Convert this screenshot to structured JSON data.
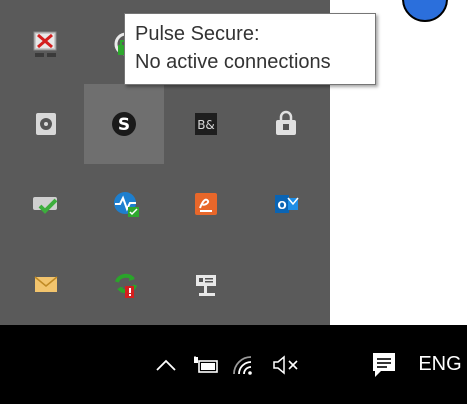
{
  "tooltip": {
    "line1": "Pulse Secure:",
    "line2": "No active connections"
  },
  "tray_overflow": {
    "icons": [
      {
        "name": "network-error-icon"
      },
      {
        "name": "pulse-secure-lock-icon"
      },
      {
        "name": "hard-drive-icon"
      },
      {
        "name": "pulse-secure-icon",
        "hovered": true
      },
      {
        "name": "beats-audio-icon"
      },
      {
        "name": "lock-icon"
      },
      {
        "name": "sync-check-icon"
      },
      {
        "name": "network-monitor-icon"
      },
      {
        "name": "signature-app-icon"
      },
      {
        "name": "outlook-icon"
      },
      {
        "name": "mail-icon"
      },
      {
        "name": "sync-error-icon"
      },
      {
        "name": "projector-icon"
      }
    ]
  },
  "taskbar": {
    "icons": [
      "chevron-up-icon",
      "battery-icon",
      "wifi-icon",
      "volume-muted-icon",
      "action-center-icon"
    ],
    "language": "ENG"
  },
  "colors": {
    "overflow_bg": "#5a5a5a",
    "hover_bg": "#6f6f6f",
    "taskbar_bg": "#000000",
    "accent": "#2b6fdc"
  }
}
